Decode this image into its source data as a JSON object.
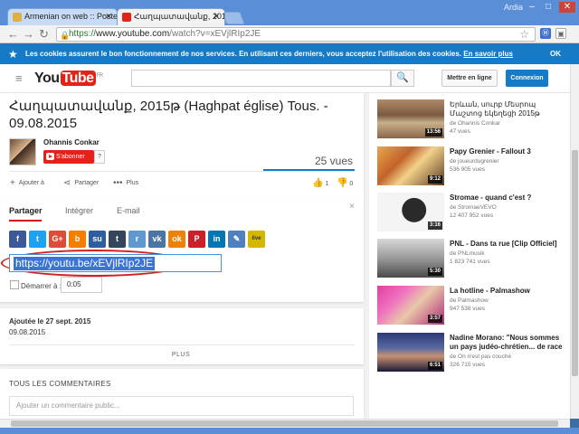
{
  "browser": {
    "tabs": [
      {
        "title": "Armenian on web :: Poster u"
      },
      {
        "title": "Հաղպատավանք, 2015թ (H"
      }
    ],
    "user": "Ardia",
    "window_buttons": [
      "–",
      "□",
      "✕"
    ],
    "url_scheme": "https://",
    "url_host": "www.youtube.com",
    "url_rest": "/watch?v=xEVjlRIp2JE",
    "extensions": [
      {
        "label": "Ⓜ",
        "color": "#3d6fcf"
      },
      {
        "label": "▣",
        "color": "#666666"
      }
    ]
  },
  "cookie_banner": {
    "text": "Les cookies assurent le bon fonctionnement de nos services. En utilisant ces derniers, vous acceptez l'utilisation des cookies.",
    "link": "En savoir plus",
    "ok": "OK",
    "color": "#167ac6"
  },
  "yt_header": {
    "logo_you": "You",
    "logo_tube": "Tube",
    "logo_region": "FR",
    "upload_label": "Mettre en ligne",
    "login_label": "Connexion"
  },
  "video": {
    "title": "Հաղպատավանք, 2015թ (Haghpat église) Tous. - 09.08.2015",
    "channel": "Ohannis Conkar",
    "subscribe_label": "S'abonner",
    "subscriber_count": "?",
    "views": "25 vues",
    "actions": {
      "add": "Ajouter à",
      "share": "Partager",
      "more": "Plus"
    },
    "likes": "1",
    "dislikes": "0"
  },
  "share": {
    "tabs": [
      "Partager",
      "Intégrer",
      "E-mail"
    ],
    "close": "×",
    "networks": [
      {
        "label": "f",
        "color": "#3b5998"
      },
      {
        "label": "t",
        "color": "#1da1f2"
      },
      {
        "label": "G+",
        "color": "#dd4b39"
      },
      {
        "label": "b",
        "color": "#f57d00"
      },
      {
        "label": "su",
        "color": "#2e5ea0"
      },
      {
        "label": "t",
        "color": "#35465c"
      },
      {
        "label": "r",
        "color": "#5f99cf"
      },
      {
        "label": "vk",
        "color": "#4c75a3"
      },
      {
        "label": "ok",
        "color": "#ee8208"
      },
      {
        "label": "P",
        "color": "#cb2027"
      },
      {
        "label": "in",
        "color": "#0077b5"
      },
      {
        "label": "✎",
        "color": "#5080c0"
      },
      {
        "label": "live",
        "color": "#d4b800"
      }
    ],
    "url": "https://youtu.be/xEVjlRIp2JE",
    "start_label": "Démarrer à :",
    "start_time": "0:05"
  },
  "description": {
    "published": "Ajoutée le 27 sept. 2015",
    "date": "09.08.2015",
    "more": "PLUS"
  },
  "comments": {
    "title": "TOUS LES COMMENTAIRES",
    "placeholder": "Ajouter un commentaire public..."
  },
  "recommended": [
    {
      "title": "Երևան, սուրբ Մեսրոպ Մաշտոց եկեղեցի 2015թ",
      "channel": "de Ohannis Conkar",
      "views": "47 vues",
      "duration": "13:56"
    },
    {
      "title": "Papy Grenier - Fallout 3",
      "channel": "de joueurdugrenier",
      "views": "536 905 vues",
      "duration": "9:12"
    },
    {
      "title": "Stromae - quand c'est ?",
      "channel": "de StromaeVEVO",
      "views": "12 407 952 vues",
      "duration": "3:16"
    },
    {
      "title": "PNL - Dans ta rue [Clip Officiel]",
      "channel": "de PNLmusik",
      "views": "1 823 741 vues",
      "duration": "5:30"
    },
    {
      "title": "La hotline - Palmashow",
      "channel": "de Palmashow",
      "views": "947 538 vues",
      "duration": "3:57"
    },
    {
      "title": "Nadine Morano: \"Nous sommes un pays judéo-chrétien... de race",
      "channel": "de On n'est pas couché",
      "views": "326 715 vues",
      "duration": "6:51"
    }
  ]
}
